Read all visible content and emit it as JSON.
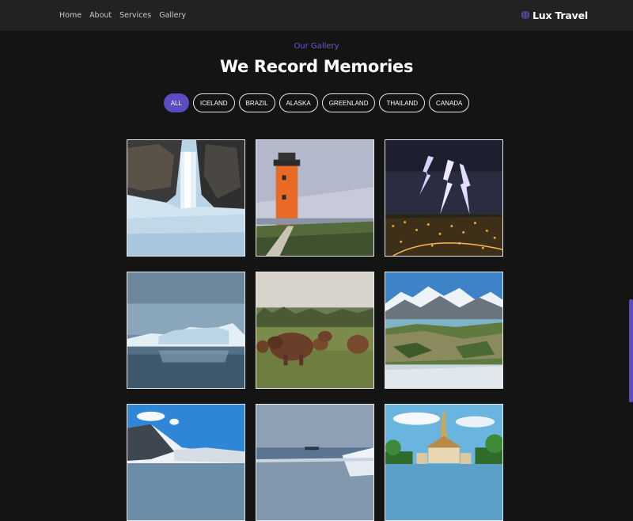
{
  "nav": {
    "links": [
      "Home",
      "About",
      "Services",
      "Gallery"
    ],
    "brand": "Lux Travel",
    "brand_icon": "globe-icon"
  },
  "section": {
    "subtitle": "Our Gallery",
    "title": "We Record Memories"
  },
  "filters": [
    "ALL",
    "ICELAND",
    "BRAZIL",
    "ALASKA",
    "GREENLAND",
    "THAILAND",
    "CANADA"
  ],
  "active_filter": "ALL",
  "colors": {
    "accent": "#5b4cc4",
    "background": "#141414",
    "navbar": "#222222"
  },
  "gallery": [
    {
      "name": "waterfall-photo"
    },
    {
      "name": "lighthouse-photo"
    },
    {
      "name": "lightning-city-photo"
    },
    {
      "name": "iceberg-photo"
    },
    {
      "name": "capybaras-photo"
    },
    {
      "name": "mountain-lake-photo"
    },
    {
      "name": "snowy-mountains-photo"
    },
    {
      "name": "icy-sea-ship-photo"
    },
    {
      "name": "temple-photo"
    }
  ]
}
